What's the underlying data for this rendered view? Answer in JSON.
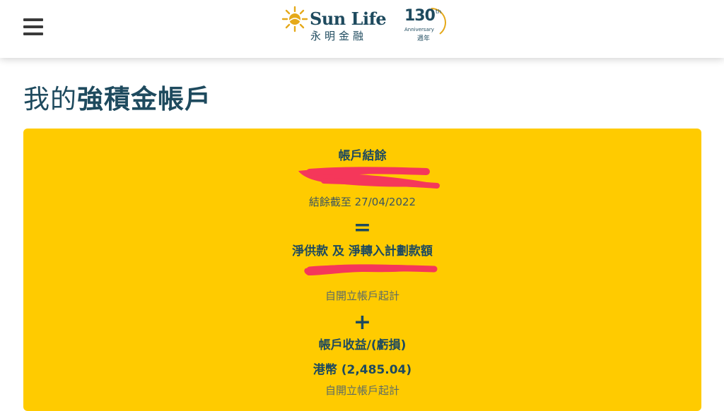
{
  "header": {
    "brand": "Sun Life",
    "brand_sub": "永明金融",
    "anniversary_number": "130",
    "anniversary_suffix": "th",
    "anniversary_word": "Anniversary",
    "anniversary_zh": "週年"
  },
  "page": {
    "title_prefix": "我的",
    "title_bold": "強積金帳戶"
  },
  "account_card": {
    "balance_label": "帳戶結餘",
    "balance_as_of": "結餘截至 27/04/2022",
    "equals_symbol": "=",
    "contribution_label": "淨供款 及 淨轉入計劃款額",
    "since_opening_1": "自開立帳戶起計",
    "plus_symbol": "+",
    "gain_loss_label": "帳戶收益/(虧損)",
    "gain_loss_value": "港幣 (2,485.04)",
    "since_opening_2": "自開立帳戶起計"
  },
  "colors": {
    "brand_navy": "#1e4a5e",
    "card_yellow": "#ffcb00",
    "redaction_red": "#f5375a",
    "sun_gold": "#e5a91a"
  },
  "icons": [
    "menu-icon",
    "sun-logo-icon"
  ]
}
